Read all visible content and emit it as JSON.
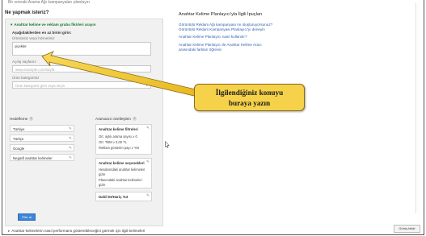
{
  "page": {
    "top_cut_text": "Bir sonraki Arama Ağı kampanyaları planlayın",
    "section_title": "Ne yapmak isteriz?",
    "feedback_label": "Görüş bildir"
  },
  "form": {
    "header": "Anahtar kelime ve reklam grubu fikirleri arayın",
    "instruction": "Aşağıdakilerden en az birini girin:",
    "product_label": "Ürününüz veya hizmetiniz",
    "product_value": "çiçekler",
    "landing_label": "Açılış sayfanız",
    "landing_placeholder": "www.example.com/sayfa",
    "category_label": "Ürün kategoriniz",
    "category_placeholder": "Ürün kategorisi girin veya seçin",
    "targeting_label": "Hedefleme",
    "targeting_items": [
      "Türkiye",
      "Türkçe",
      "Google",
      "Negatif anahtar kelimeler"
    ],
    "search_label": "Aramanızı özelleştirin",
    "card1_title": "Anahtar kelime filtreleri",
    "card1_lines": [
      "Ort. aylık arama sayısı ≥ 0",
      "Ort. TBM ≥ 0,00 TL",
      "Reklam gösterim payı ≥ %0"
    ],
    "card2_title": "Anahtar kelime seçenekleri",
    "card2_lines": [
      "Hesabımdaki anahtar kelimeleri",
      "gizle",
      "Planımdaki anahtar kelimeleri",
      "gizle"
    ],
    "card3_title": "Dahil Et/Hariç Tut",
    "submit_label": "Fikir al",
    "bottom_link": "Anahtar kelimelerin nasıl performans gösterebileceğini görmek için ilgili kelimeleri"
  },
  "tips": {
    "title": "Anahtar Kelime Planlayıcı'yla İlgili İpuçları",
    "links": [
      "Görüntülü Reklam Ağı kampanyası mı oluşturuyorsunuz?",
      "Görüntülü Reklam Kampanyası Planlayıcı'yı deneyin",
      "Anahtar Kelime Planlayıcı nasıl kullanılır?",
      "Anahtar Kelime Planlayıcı ile Anahtar Kelime Aracı",
      "arasındaki farkları öğrenin"
    ]
  },
  "callout": {
    "line1": "İlgilendiğiniz konuyu",
    "line2": "buraya yazın",
    "fill_color": "#f5d24a",
    "border_color": "#8a6a14"
  },
  "icons": {
    "help": "?",
    "pencil": "✎",
    "dropdown": "▾",
    "triangle": "▾",
    "triangle_right": "▸"
  },
  "colors": {
    "accent_green": "#1a7a2a",
    "link_blue": "#2d5fa8",
    "button_blue": "#3d85d8"
  }
}
